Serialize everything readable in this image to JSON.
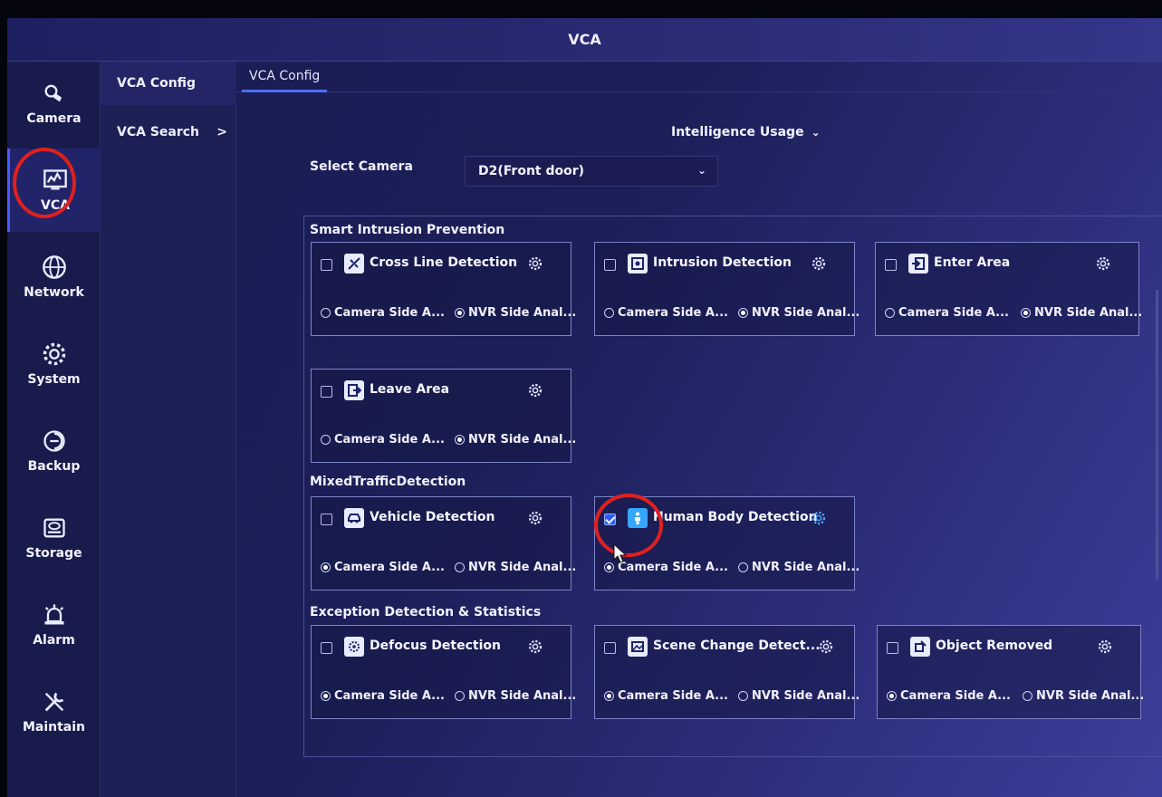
{
  "window": {
    "title": "VCA"
  },
  "nav": {
    "items": [
      {
        "label": "Camera"
      },
      {
        "label": "VCA"
      },
      {
        "label": "Network"
      },
      {
        "label": "System"
      },
      {
        "label": "Backup"
      },
      {
        "label": "Storage"
      },
      {
        "label": "Alarm"
      },
      {
        "label": "Maintain"
      }
    ]
  },
  "submenu": {
    "items": [
      {
        "label": "VCA Config"
      },
      {
        "label": "VCA Search",
        "chevron": ">"
      }
    ]
  },
  "tabs": [
    {
      "label": "VCA Config"
    }
  ],
  "usage": {
    "label": "Intelligence Usage",
    "chevron": "⌄"
  },
  "camera": {
    "label": "Select Camera",
    "selected": "D2(Front door)",
    "chevron": "⌄"
  },
  "sections": [
    {
      "title": "Smart Intrusion Prevention"
    },
    {
      "title": "MixedTrafficDetection"
    },
    {
      "title": "Exception Detection & Statistics"
    }
  ],
  "options": {
    "camera": "Camera Side A...",
    "nvr": "NVR Side Anal..."
  },
  "cards": [
    {
      "title": "Cross Line Detection",
      "checked": false,
      "mode": "nvr"
    },
    {
      "title": "Intrusion Detection",
      "checked": false,
      "mode": "nvr"
    },
    {
      "title": "Enter Area",
      "checked": false,
      "mode": "nvr"
    },
    {
      "title": "Leave Area",
      "checked": false,
      "mode": "nvr"
    },
    {
      "title": "Vehicle Detection",
      "checked": false,
      "mode": "camera"
    },
    {
      "title": "Human Body Detection",
      "checked": true,
      "mode": "camera"
    },
    {
      "title": "Defocus Detection",
      "checked": false,
      "mode": "camera"
    },
    {
      "title": "Scene Change Detect...",
      "checked": false,
      "mode": "camera"
    },
    {
      "title": "Object Removed",
      "checked": false,
      "mode": "camera"
    }
  ],
  "accent": "#4f6dff",
  "annotation_color": "#e0201e"
}
